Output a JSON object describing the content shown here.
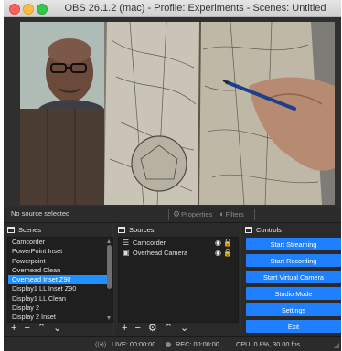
{
  "window": {
    "title": "OBS 26.1.2 (mac) - Profile: Experiments - Scenes: Untitled"
  },
  "context_bar": {
    "source_label": "No source selected",
    "properties_label": "Properties",
    "filters_label": "Filters"
  },
  "scenes": {
    "header": "Scenes",
    "items": [
      {
        "label": "Camcorder"
      },
      {
        "label": "PowerPoint Inset"
      },
      {
        "label": "Powerpoint"
      },
      {
        "label": "Overhead Clean"
      },
      {
        "label": "Overhead Inset Z90"
      },
      {
        "label": "Display1 LL Inset Z90"
      },
      {
        "label": "Display1 LL Clean"
      },
      {
        "label": "Display 2"
      },
      {
        "label": "Display 2 Inset"
      }
    ],
    "selected_index": 4
  },
  "sources": {
    "header": "Sources",
    "items": [
      {
        "label": "Camcorder",
        "icon": "camera-icon"
      },
      {
        "label": "Overhead Camera",
        "icon": "camera-icon"
      }
    ]
  },
  "controls": {
    "header": "Controls",
    "buttons": [
      {
        "label": "Start Streaming"
      },
      {
        "label": "Start Recording"
      },
      {
        "label": "Start Virtual Camera"
      },
      {
        "label": "Studio Mode"
      },
      {
        "label": "Settings"
      },
      {
        "label": "Exit"
      }
    ],
    "accent": "#1e7fff"
  },
  "status": {
    "live": "LIVE: 00:00:00",
    "rec": "REC: 00:00:00",
    "cpu": "CPU: 0.8%, 30.00 fps"
  }
}
